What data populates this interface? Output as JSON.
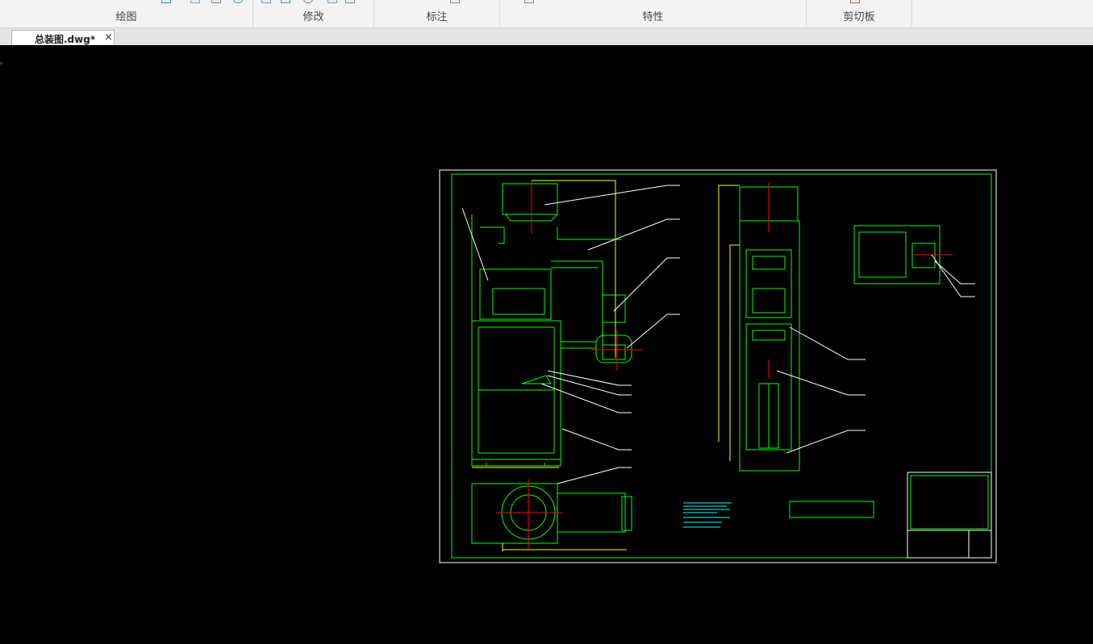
{
  "ribbon": {
    "groups": [
      {
        "id": "draw",
        "label": "绘图"
      },
      {
        "id": "modify",
        "label": "修改"
      },
      {
        "id": "annotate",
        "label": "标注"
      },
      {
        "id": "properties",
        "label": "特性"
      },
      {
        "id": "clipboard",
        "label": "剪切板"
      }
    ]
  },
  "tabs": [
    {
      "label": "总装图.dwg*",
      "close": "×",
      "active": true
    }
  ],
  "colors": {
    "frame": "#ffffff",
    "outline": "#00ff00",
    "centerline": "#ff0000",
    "dimension": "#ffff00",
    "text": "#00ffff",
    "magenta": "#ff00ff",
    "leader": "#ffffff"
  }
}
